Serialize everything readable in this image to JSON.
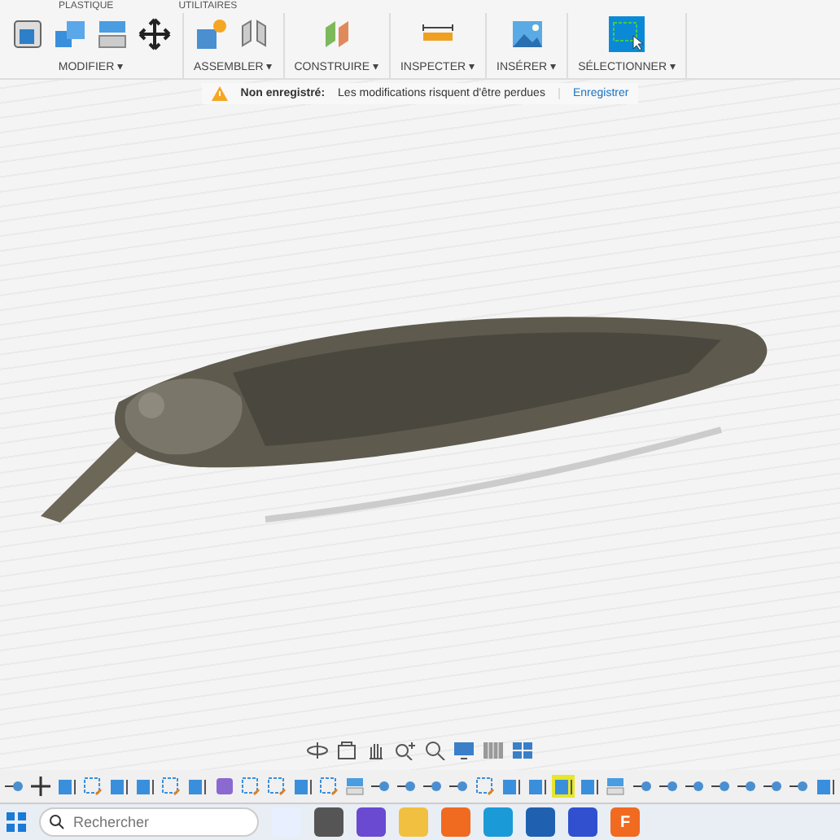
{
  "ribbon": {
    "tabs": [
      {
        "label": "PLASTIQUE"
      },
      {
        "label": "UTILITAIRES"
      }
    ],
    "groups": [
      {
        "label": "MODIFIER ▾",
        "tools": [
          {
            "kind": "box"
          },
          {
            "kind": "cubes"
          },
          {
            "kind": "layers"
          },
          {
            "kind": "move"
          }
        ]
      },
      {
        "label": "ASSEMBLER ▾",
        "tools": [
          {
            "kind": "component"
          },
          {
            "kind": "joint"
          }
        ]
      },
      {
        "label": "CONSTRUIRE ▾",
        "tools": [
          {
            "kind": "plane"
          }
        ]
      },
      {
        "label": "INSPECTER ▾",
        "tools": [
          {
            "kind": "ruler"
          }
        ]
      },
      {
        "label": "INSÉRER ▾",
        "tools": [
          {
            "kind": "image"
          }
        ]
      },
      {
        "label": "SÉLECTIONNER ▾",
        "tools": [
          {
            "kind": "select"
          }
        ]
      }
    ]
  },
  "notice": {
    "title": "Non enregistré:",
    "message": "Les modifications risquent d'être perdues",
    "action": "Enregistrer"
  },
  "nav_tools": [
    {
      "kind": "orbit"
    },
    {
      "kind": "look"
    },
    {
      "kind": "pan"
    },
    {
      "kind": "zoom"
    },
    {
      "kind": "fit"
    },
    {
      "kind": "display"
    },
    {
      "kind": "grid"
    },
    {
      "kind": "viewports"
    }
  ],
  "timeline": [
    {
      "kind": "joint",
      "selected": false
    },
    {
      "kind": "move",
      "selected": false
    },
    {
      "kind": "body",
      "selected": false
    },
    {
      "kind": "sketch",
      "selected": false
    },
    {
      "kind": "body",
      "selected": false
    },
    {
      "kind": "body",
      "selected": false
    },
    {
      "kind": "sketch",
      "selected": false
    },
    {
      "kind": "body",
      "selected": false
    },
    {
      "kind": "component",
      "selected": false
    },
    {
      "kind": "sketch",
      "selected": false
    },
    {
      "kind": "sketch",
      "selected": false
    },
    {
      "kind": "body",
      "selected": false
    },
    {
      "kind": "sketch",
      "selected": false
    },
    {
      "kind": "shell",
      "selected": false
    },
    {
      "kind": "joint",
      "selected": false
    },
    {
      "kind": "joint",
      "selected": false
    },
    {
      "kind": "joint",
      "selected": false
    },
    {
      "kind": "joint",
      "selected": false
    },
    {
      "kind": "sketch",
      "selected": false
    },
    {
      "kind": "body",
      "selected": false
    },
    {
      "kind": "body",
      "selected": false
    },
    {
      "kind": "body",
      "selected": true
    },
    {
      "kind": "body",
      "selected": false
    },
    {
      "kind": "shell",
      "selected": false
    },
    {
      "kind": "joint",
      "selected": false
    },
    {
      "kind": "joint",
      "selected": false
    },
    {
      "kind": "joint",
      "selected": false
    },
    {
      "kind": "joint",
      "selected": false
    },
    {
      "kind": "joint",
      "selected": false
    },
    {
      "kind": "joint",
      "selected": false
    },
    {
      "kind": "joint",
      "selected": false
    },
    {
      "kind": "body",
      "selected": false
    }
  ],
  "taskbar": {
    "search_placeholder": "Rechercher",
    "apps": [
      {
        "kind": "copilot"
      },
      {
        "kind": "files"
      },
      {
        "kind": "meet"
      },
      {
        "kind": "folder"
      },
      {
        "kind": "firefox"
      },
      {
        "kind": "edge"
      },
      {
        "kind": "store"
      },
      {
        "kind": "vscode"
      },
      {
        "kind": "fusion",
        "letter": "F"
      }
    ]
  }
}
